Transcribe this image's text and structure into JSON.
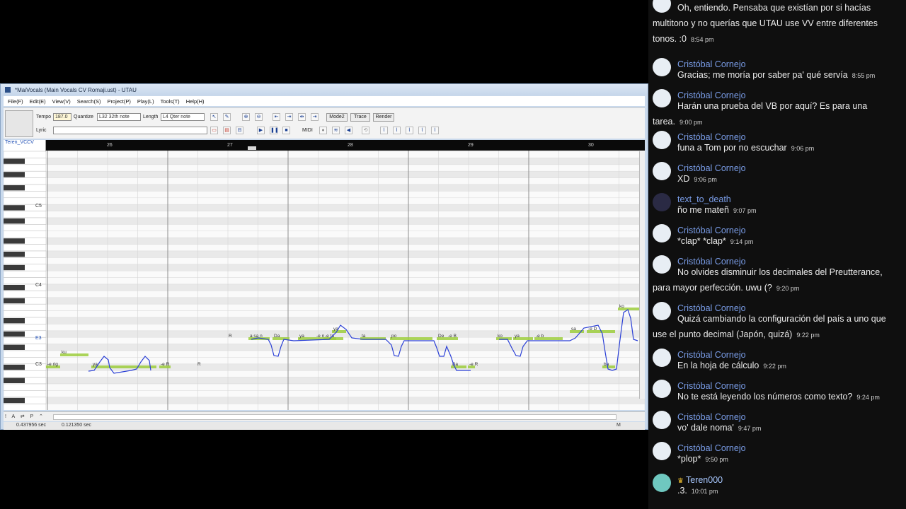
{
  "window": {
    "title": "*MaiVocals (Main Vocals CV Romaji.ust) - UTAU",
    "menus": [
      "File(F)",
      "Edit(E)",
      "View(V)",
      "Search(S)",
      "Project(P)",
      "Play(L)",
      "Tools(T)",
      "Help(H)"
    ],
    "toolbar": {
      "tempo_label": "Tempo",
      "tempo_value": "187.0",
      "quantize_label": "Quantize",
      "quantize_value": "L32 32th note",
      "length_label": "Length",
      "length_value": "L4  Qter note",
      "mode_button": "Mode2",
      "trace_button": "Trace",
      "render_button": "Render",
      "lyric_label": "Lyric",
      "midi_label": "MIDI"
    },
    "track_name": "Teren_VCCV",
    "measures": [
      "26",
      "27",
      "28",
      "29",
      "30"
    ],
    "key_labels": [
      "C5",
      "C4",
      "E3",
      "C3"
    ],
    "status": {
      "left": "0.437956 sec",
      "mid": "0.121350 sec",
      "right": "M"
    },
    "notes": [
      {
        "lyric": "-e rig",
        "pitch": "C3"
      },
      {
        "lyric": "ku",
        "pitch": "D3"
      },
      {
        "lyric": "ya",
        "pitch": "C3"
      },
      {
        "lyric": "-e R",
        "pitch": "C3"
      },
      {
        "lyric": "R",
        "pitch": "C3"
      },
      {
        "lyric": "R",
        "pitch": "E3"
      },
      {
        "lyric": "a sa n",
        "pitch": "E3"
      },
      {
        "lyric": "Da",
        "pitch": "E3"
      },
      {
        "lyric": "ya",
        "pitch": "E3"
      },
      {
        "lyric": "-e n",
        "pitch": "E3"
      },
      {
        "lyric": "-e ta",
        "pitch": "E3"
      },
      {
        "lyric": "ya",
        "pitch": "F3"
      },
      {
        "lyric": "ta",
        "pitch": "E3"
      },
      {
        "lyric": "po",
        "pitch": "E3"
      },
      {
        "lyric": "De",
        "pitch": "E3"
      },
      {
        "lyric": "-e B",
        "pitch": "E3"
      },
      {
        "lyric": "Ba",
        "pitch": "C3"
      },
      {
        "lyric": "-e R",
        "pitch": "C3"
      },
      {
        "lyric": "ko",
        "pitch": "E3"
      },
      {
        "lyric": "ya",
        "pitch": "E3"
      },
      {
        "lyric": "-e b",
        "pitch": "E3"
      },
      {
        "lyric": "sa",
        "pitch": "F3"
      },
      {
        "lyric": "-e D",
        "pitch": "F3"
      },
      {
        "lyric": "ko",
        "pitch": "G3"
      },
      {
        "lyric": "ba",
        "pitch": "C3"
      }
    ]
  },
  "chat": {
    "messages": [
      {
        "author": "",
        "text": "Oh, entiendo. Pensaba que existían por si hacías multitono y no querías que UTAU use VV entre diferentes tonos. :0",
        "time": "8:54 pm",
        "avatar": "light"
      },
      {
        "author": "Cristóbal Cornejo",
        "text": "Gracias; me moría por saber pa' qué servía",
        "time": "8:55 pm",
        "avatar": "light"
      },
      {
        "author": "Cristóbal Cornejo",
        "text": "Harán una prueba del VB por aquí? Es para una tarea.",
        "time": "9:00 pm",
        "avatar": "light"
      },
      {
        "author": "Cristóbal Cornejo",
        "text": "funa a Tom por no escuchar",
        "time": "9:06 pm",
        "avatar": "light"
      },
      {
        "author": "Cristóbal Cornejo",
        "text": "XD",
        "time": "9:06 pm",
        "avatar": "light"
      },
      {
        "author": "text_to_death",
        "text": "ño me mateñ",
        "time": "9:07 pm",
        "avatar": "dark"
      },
      {
        "author": "Cristóbal Cornejo",
        "text": "*clap* *clap*",
        "time": "9:14 pm",
        "avatar": "light"
      },
      {
        "author": "Cristóbal Cornejo",
        "text": "No olvides disminuir los decimales del Preutterance, para mayor perfección. uwu (?",
        "time": "9:20 pm",
        "avatar": "light"
      },
      {
        "author": "Cristóbal Cornejo",
        "text": "Quizá cambiando la configuración del país a uno que use el punto decimal (Japón, quizá)",
        "time": "9:22 pm",
        "avatar": "light"
      },
      {
        "author": "Cristóbal Cornejo",
        "text": "En la hoja de cálculo",
        "time": "9:22 pm",
        "avatar": "light"
      },
      {
        "author": "Cristóbal Cornejo",
        "text": "No te está leyendo los números como texto?",
        "time": "9:24 pm",
        "avatar": "light"
      },
      {
        "author": "Cristóbal Cornejo",
        "text": "vo' dale noma'",
        "time": "9:47 pm",
        "avatar": "light"
      },
      {
        "author": "Cristóbal Cornejo",
        "text": "*plop*",
        "time": "9:50 pm",
        "avatar": "light"
      },
      {
        "author": "Teren000",
        "text": ".3.",
        "time": "10:01 pm",
        "avatar": "teal",
        "owner": true
      }
    ]
  },
  "colors": {
    "chat_bg": "#0f0f0f",
    "author": "#7a9de8",
    "note_green": "#9ccc3c",
    "pitch_blue": "#2a3fd6",
    "window_frame": "#c9d9ec"
  }
}
